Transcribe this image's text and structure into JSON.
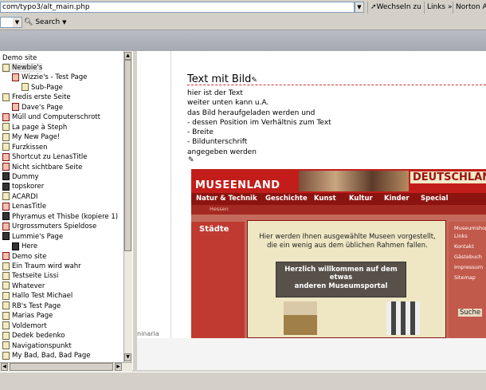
{
  "browser": {
    "address": "com/typo3/alt_main.php",
    "buttons": [
      "Wechseln zu",
      "Links",
      "Norton AntiVirus"
    ],
    "search_label": "Search"
  },
  "tree": {
    "root": "Demo site",
    "items": [
      {
        "label": "Newbie's",
        "indent": 0,
        "icon": "page",
        "selected": true
      },
      {
        "label": "Wizzie's - Test Page",
        "indent": 1,
        "icon": "page-red"
      },
      {
        "label": "Sub-Page",
        "indent": 2,
        "icon": "page"
      },
      {
        "label": "Fredis erste Seite",
        "indent": 0,
        "icon": "page"
      },
      {
        "label": "Dave's Page",
        "indent": 1,
        "icon": "page-red"
      },
      {
        "label": "Müll und Computerschrott",
        "indent": 0,
        "icon": "page-red"
      },
      {
        "label": "La page à Steph",
        "indent": 0,
        "icon": "page"
      },
      {
        "label": "My New Page!",
        "indent": 0,
        "icon": "page"
      },
      {
        "label": "Furzkissen",
        "indent": 0,
        "icon": "page"
      },
      {
        "label": "Shortcut zu LenasTitle",
        "indent": 0,
        "icon": "page-red"
      },
      {
        "label": "Nicht sichtbare Seite",
        "indent": 0,
        "icon": "page-red"
      },
      {
        "label": "Dummy",
        "indent": 0,
        "icon": "page-dark"
      },
      {
        "label": "topskorer",
        "indent": 0,
        "icon": "page-dark"
      },
      {
        "label": "ACARDI",
        "indent": 0,
        "icon": "page"
      },
      {
        "label": "LenasTitle",
        "indent": 0,
        "icon": "page-red"
      },
      {
        "label": "Phyramus et Thisbe (kopiere 1)",
        "indent": 0,
        "icon": "page-dark"
      },
      {
        "label": "Urgrossmuters Spieldose",
        "indent": 0,
        "icon": "page-red"
      },
      {
        "label": "Lummie's Page",
        "indent": 0,
        "icon": "page-dark"
      },
      {
        "label": "Here",
        "indent": 1,
        "icon": "page-dark"
      },
      {
        "label": "Demo site",
        "indent": 0,
        "icon": "page-red"
      },
      {
        "label": "Ein Traum wird wahr",
        "indent": 0,
        "icon": "page"
      },
      {
        "label": "Testseite Lissi",
        "indent": 0,
        "icon": "page"
      },
      {
        "label": "Whatever",
        "indent": 0,
        "icon": "page"
      },
      {
        "label": "Hallo Test Michael",
        "indent": 0,
        "icon": "page"
      },
      {
        "label": "RB's Test Page",
        "indent": 0,
        "icon": "page"
      },
      {
        "label": "Marias Page",
        "indent": 0,
        "icon": "page"
      },
      {
        "label": "Voldemort",
        "indent": 0,
        "icon": "page"
      },
      {
        "label": "Dedek bedenko",
        "indent": 0,
        "icon": "page"
      },
      {
        "label": "Navigationspunkt",
        "indent": 0,
        "icon": "page"
      },
      {
        "label": "My Bad, Bad, Bad Page",
        "indent": 0,
        "icon": "page"
      }
    ]
  },
  "content": {
    "title": "Text mit Bild",
    "lines": [
      "hier ist der Text",
      "weiter unten kann u.A.",
      "das Bild heraufgeladen werden und",
      "- dessen Position im Verhältnis zum Text",
      "- Breite",
      "- Bildunterschrift",
      "angegeben werden"
    ],
    "partial_text": "ninaria"
  },
  "museum": {
    "logo": "MUSEENLAND",
    "country": "DEUTSCHLAND",
    "nav": [
      "Natur & Technik",
      "Geschichte",
      "Kunst",
      "Kultur",
      "Kinder",
      "Special"
    ],
    "region": "Hessen",
    "left_title": "Städte",
    "intro": "Hier werden Ihnen ausgewählte Museen vorgestellt, die ein wenig aus dem üblichen Rahmen fallen.",
    "welcome_line1": "Herzlich willkommen auf dem etwas",
    "welcome_line2": "anderen Museumsportal",
    "right_links": [
      "Museumshop",
      "Links",
      "Kontakt",
      "Gästebuch",
      "Impressum",
      "Sitemap"
    ],
    "search": "Suche"
  }
}
